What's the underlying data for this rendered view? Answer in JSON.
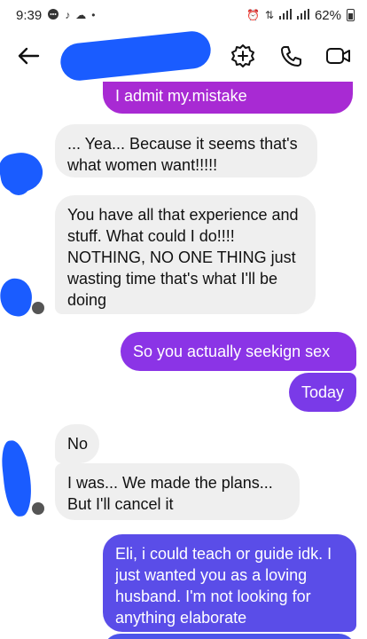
{
  "status_bar": {
    "time": "9:39",
    "battery": "62%",
    "left_icons": [
      "message-icon",
      "tiktok-icon",
      "cloud-icon",
      "dot-icon"
    ],
    "right_icons": [
      "alarm-icon",
      "data-icon",
      "signal-icon",
      "signal-icon",
      "battery-icon"
    ]
  },
  "header": {
    "contact_name_redacted": true,
    "actions": [
      "add-effects-icon",
      "phone-icon",
      "video-icon"
    ]
  },
  "messages": [
    {
      "direction": "outgoing",
      "text": "I admit my.mistake"
    },
    {
      "direction": "incoming",
      "text": "... Yea... Because it seems that's what women want!!!!!"
    },
    {
      "direction": "incoming",
      "text": "You have all that experience and stuff. What could I do!!!! NOTHING, NO ONE THING just wasting time that's what I'll be doing"
    },
    {
      "direction": "outgoing",
      "text": "So you actually seekign sex"
    },
    {
      "direction": "outgoing",
      "text": "Today"
    },
    {
      "direction": "incoming",
      "text": "No"
    },
    {
      "direction": "incoming",
      "text": "I was... We made the plans... But I'll cancel it"
    },
    {
      "direction": "outgoing",
      "text": "Eli, i could teach or guide idk. I just wanted you as a loving husband. I'm not looking for anything elaborate"
    }
  ],
  "colors": {
    "incoming_bubble": "#efefef",
    "outgoing_purple": "#8b34e6",
    "outgoing_blue": "#5a4de8",
    "redaction": "#1a5cff"
  }
}
